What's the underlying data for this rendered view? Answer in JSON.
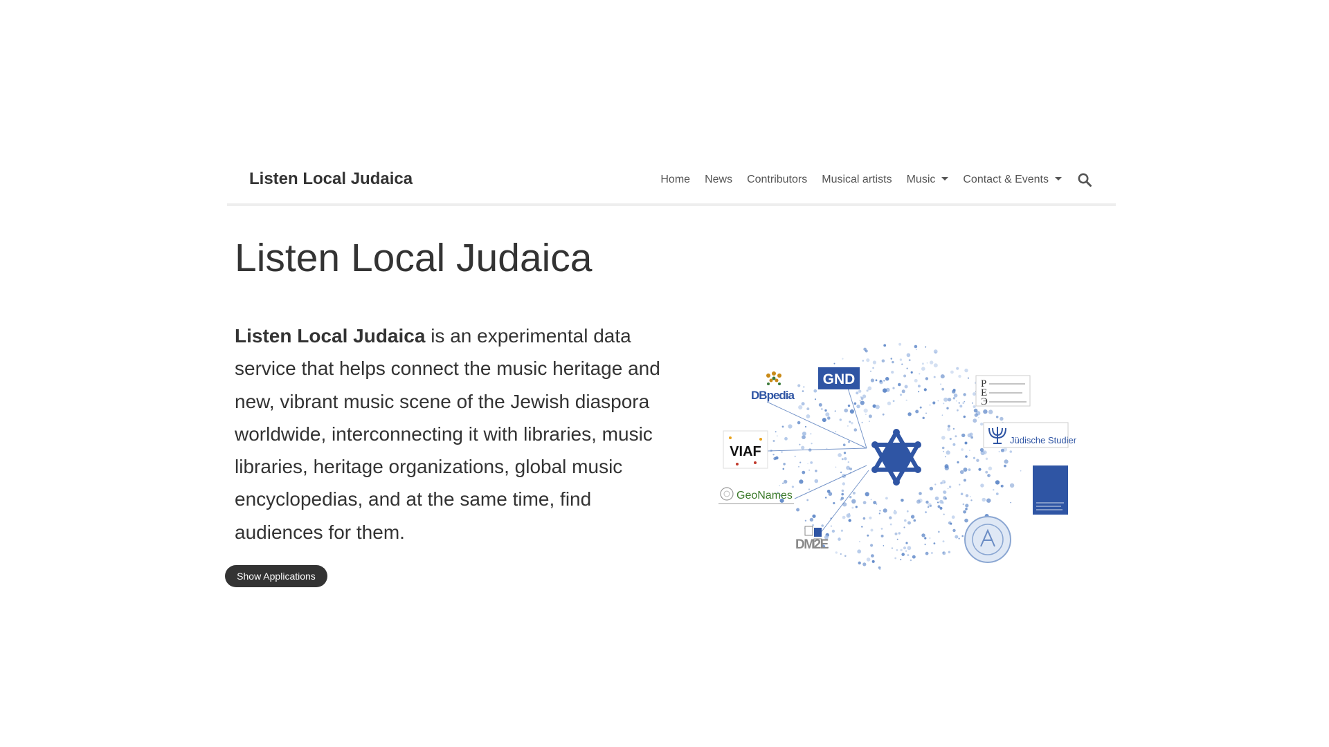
{
  "navbar": {
    "brand": "Listen Local Judaica",
    "items": [
      {
        "label": "Home",
        "dropdown": false
      },
      {
        "label": "News",
        "dropdown": false
      },
      {
        "label": "Contributors",
        "dropdown": false
      },
      {
        "label": "Musical artists",
        "dropdown": false
      },
      {
        "label": "Music",
        "dropdown": true
      },
      {
        "label": "Contact & Events",
        "dropdown": true
      }
    ],
    "search_icon": "search-icon"
  },
  "main": {
    "title": "Listen Local Judaica",
    "lead_bold": "Listen Local Judaica",
    "lead_text": " is an experimental data service that helps connect the music heritage and new, vibrant music scene of the Jewish diaspora worldwide, interconnecting it with libraries, music libraries, heritage organizations, global music encyclopedias, and at the same time, find audiences for them.",
    "show_applications_label": "Show Applications"
  },
  "graphic": {
    "center_icon": "star-of-david-icon",
    "logos": {
      "gnd": "GND",
      "dbpedia": "DBpedia",
      "viaf": "VIAF",
      "geonames": "GeoNames",
      "dm2e": "DM2E",
      "judische_studien": "Jüdische Studien"
    }
  },
  "colors": {
    "accent_blue": "#2f55a4",
    "text": "#333333",
    "button_bg": "#333333"
  }
}
